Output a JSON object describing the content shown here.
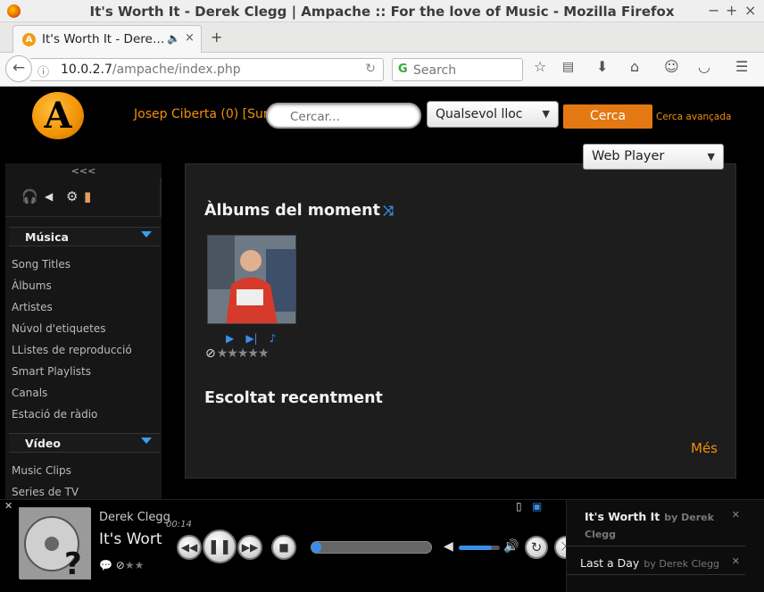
{
  "window": {
    "title": "It's Worth It - Derek Clegg | Ampache :: For the love of Music - Mozilla Firefox",
    "minimize": "−",
    "maximize": "+",
    "close": "×"
  },
  "tab": {
    "label": "It's Worth It - Derek Clegg",
    "audio_icon": "speaker-icon",
    "close": "×",
    "new_tab": "+"
  },
  "navbar": {
    "back": "←",
    "info": "ⓘ",
    "url_host": "10.0.2.7",
    "url_path": "/ampache/index.php",
    "reload": "↻",
    "search_placeholder": "Search",
    "icons": [
      "bookmark-star-icon",
      "reading-list-icon",
      "download-icon",
      "home-icon",
      "emoji-icon",
      "pocket-icon",
      "menu-icon"
    ]
  },
  "header": {
    "logo_letter": "A",
    "user": "Josep Ciberta (0)",
    "logout": "[Surt]",
    "search_placeholder": "Cercar...",
    "scope": "Qualsevol lloc",
    "search_button": "Cerca",
    "advanced": "Cerca avançada",
    "web_player": "Web Player"
  },
  "sidebar": {
    "collapse": "<<<",
    "sections": [
      {
        "title": "Música",
        "items": [
          "Song Titles",
          "Àlbums",
          "Artistes",
          "Núvol d'etiquetes",
          "LListes de reproducció",
          "Smart Playlists",
          "Canals",
          "Estació de ràdio"
        ]
      },
      {
        "title": "Vídeo",
        "items": [
          "Music Clips",
          "Series de TV"
        ]
      }
    ]
  },
  "main": {
    "albums_heading": "Àlbums del moment",
    "recent_heading": "Escoltat recentment",
    "more": "Més",
    "rating_value": 0,
    "rating_max": 5
  },
  "player": {
    "artist": "Derek Clegg",
    "title": "It's Worth It",
    "time": "00:14",
    "progress": 0.08,
    "volume": 0.8,
    "playlist": [
      {
        "title": "It's Worth It",
        "by": "by Derek Clegg"
      },
      {
        "title": "Last a Day",
        "by": "by Derek Clegg"
      }
    ]
  }
}
